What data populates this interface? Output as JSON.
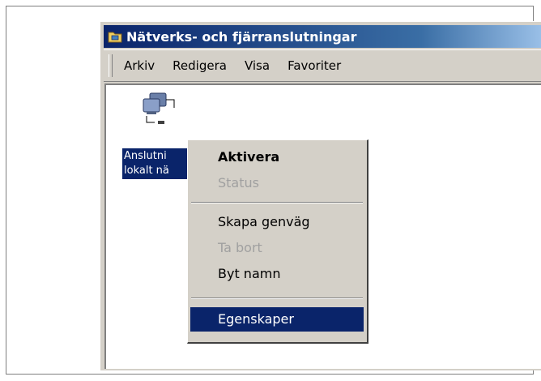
{
  "window": {
    "title": "Nätverks- och fjärranslutningar",
    "icon": "network-folder-icon"
  },
  "menubar": {
    "items": [
      "Arkiv",
      "Redigera",
      "Visa",
      "Favoriter"
    ]
  },
  "connection": {
    "icon": "network-connection-icon",
    "label_line1": "Anslutni",
    "label_line2": "lokalt nä"
  },
  "context_menu": {
    "items": [
      {
        "label": "Aktivera",
        "bold": true,
        "enabled": true
      },
      {
        "label": "Status",
        "enabled": false
      },
      {
        "label": "Skapa genväg",
        "enabled": true
      },
      {
        "label": "Ta bort",
        "enabled": false
      },
      {
        "label": "Byt namn",
        "enabled": true
      },
      {
        "label": "Egenskaper",
        "enabled": true,
        "selected": true
      }
    ]
  },
  "colors": {
    "selection": "#0a246a",
    "face": "#d4d0c8",
    "disabled_text": "#a0a0a0"
  }
}
